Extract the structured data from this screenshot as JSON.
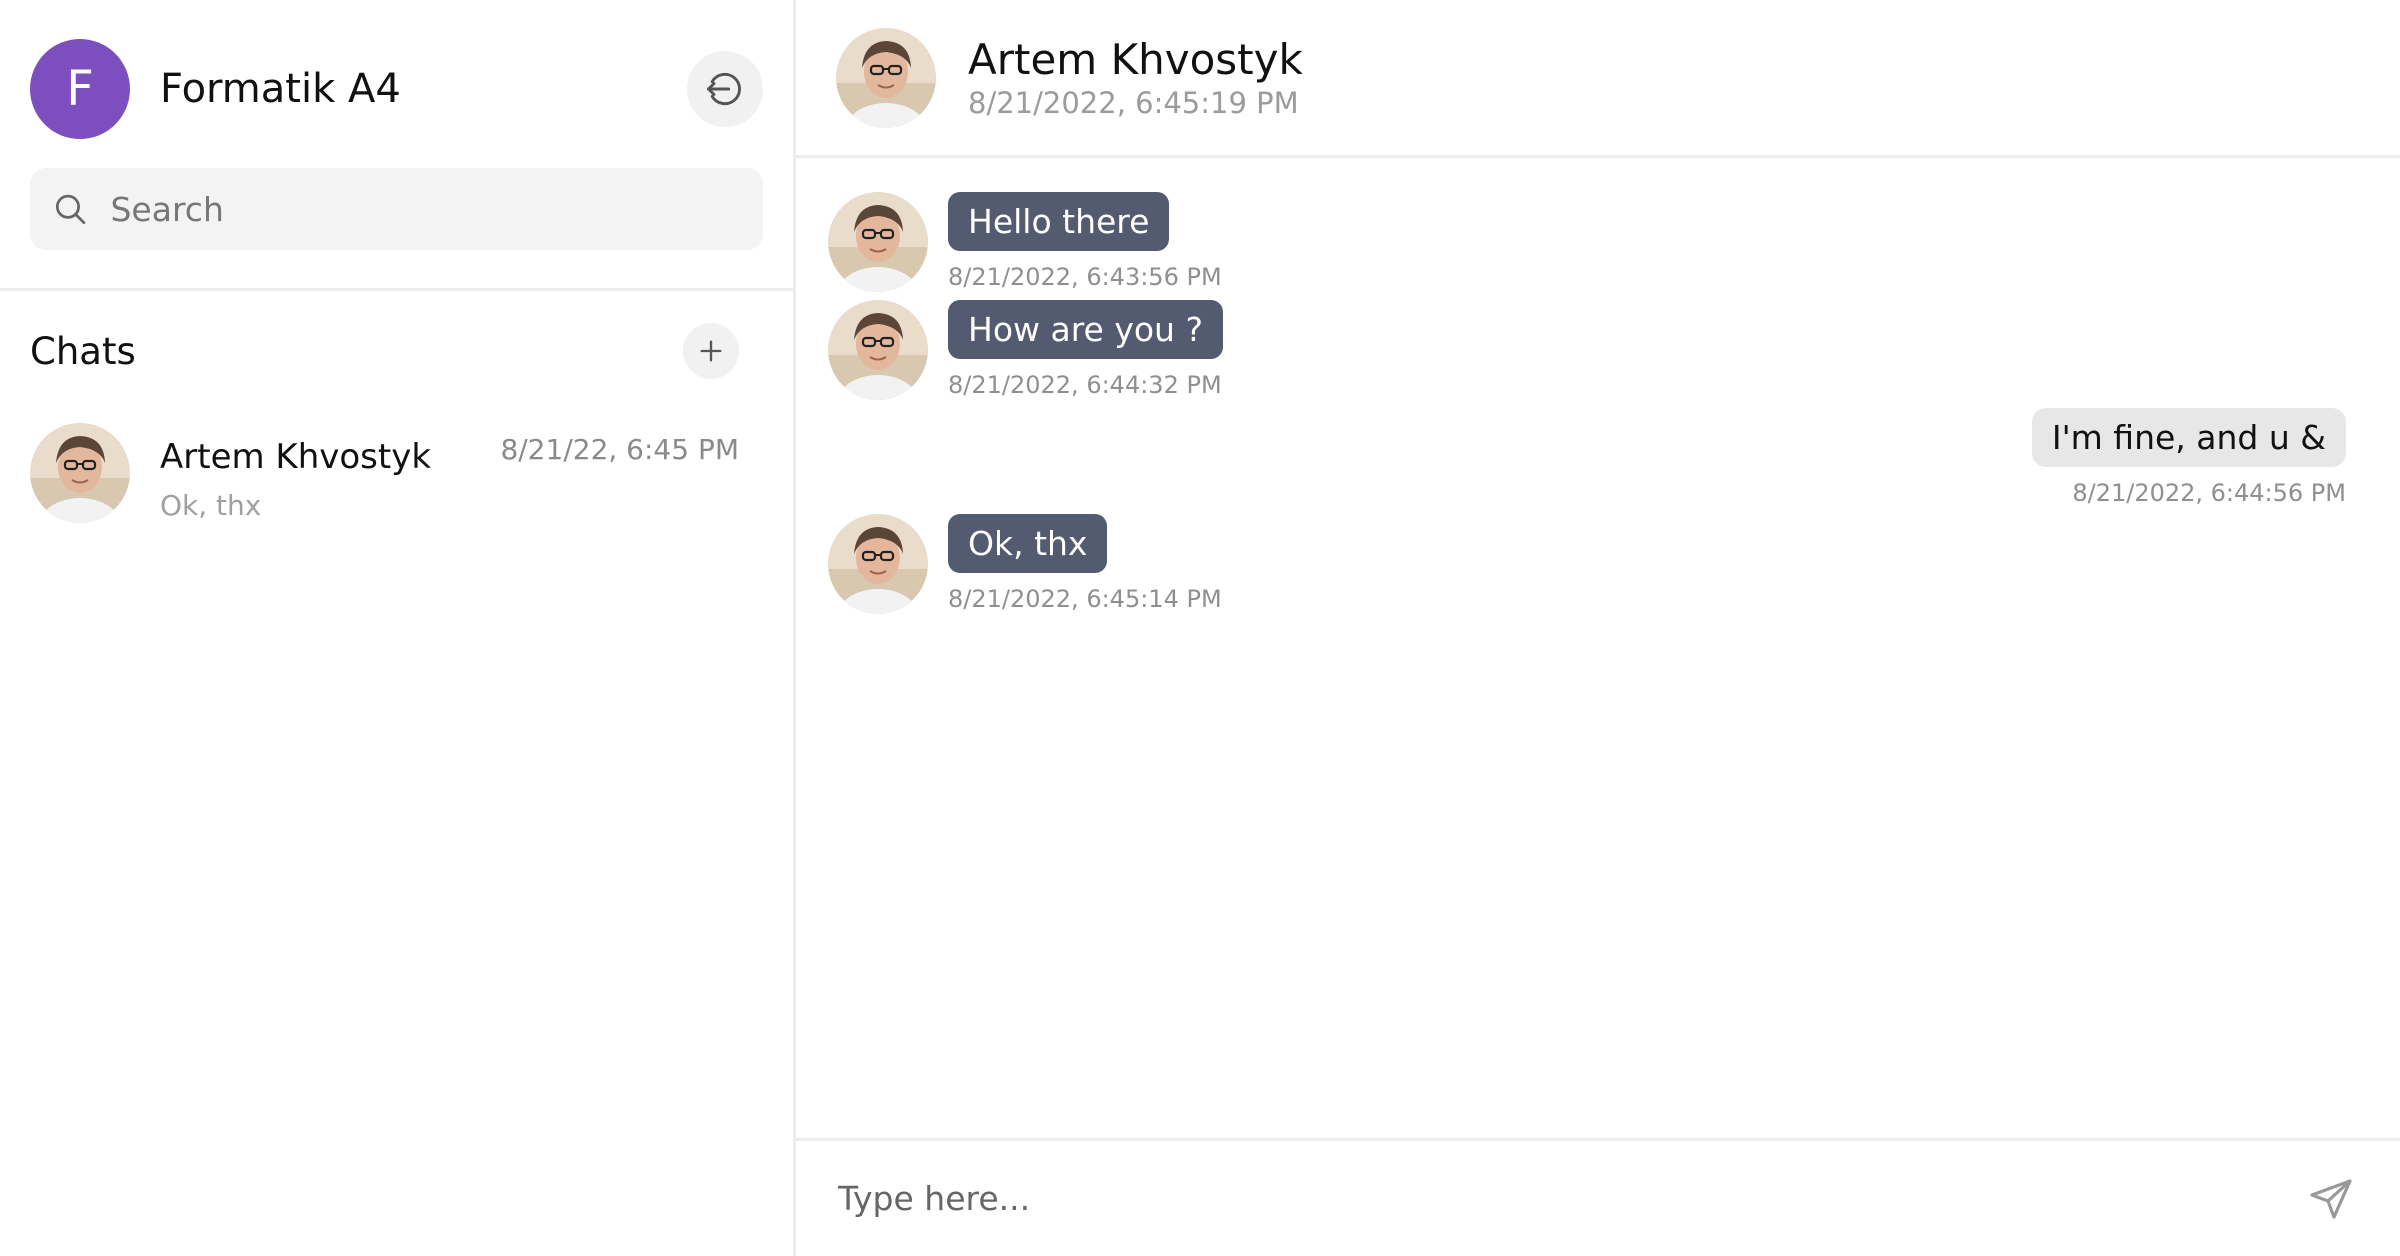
{
  "sidebar": {
    "profile": {
      "initial": "F",
      "name": "Formatik A4",
      "avatar_color": "#7d4fbe"
    },
    "logout_icon": "logout-icon",
    "search": {
      "placeholder": "Search",
      "value": ""
    },
    "chats_title": "Chats",
    "add_icon": "plus-icon",
    "chats": [
      {
        "name": "Artem Khvostyk",
        "preview": "Ok, thx",
        "time": "8/21/22, 6:45 PM"
      }
    ]
  },
  "header": {
    "name": "Artem Khvostyk",
    "status": "8/21/2022, 6:45:19 PM"
  },
  "messages": [
    {
      "direction": "in",
      "text": "Hello there",
      "time": "8/21/2022, 6:43:56 PM"
    },
    {
      "direction": "in",
      "text": "How are you ?",
      "time": "8/21/2022, 6:44:32 PM"
    },
    {
      "direction": "out",
      "text": "I'm fine, and u &",
      "time": "8/21/2022, 6:44:56 PM"
    },
    {
      "direction": "in",
      "text": "Ok, thx",
      "time": "8/21/2022, 6:45:14 PM"
    }
  ],
  "composer": {
    "placeholder": "Type here...",
    "value": ""
  },
  "colors": {
    "incoming_bubble": "#525b70",
    "outgoing_bubble": "#e7e7e7",
    "accent": "#7d4fbe"
  }
}
